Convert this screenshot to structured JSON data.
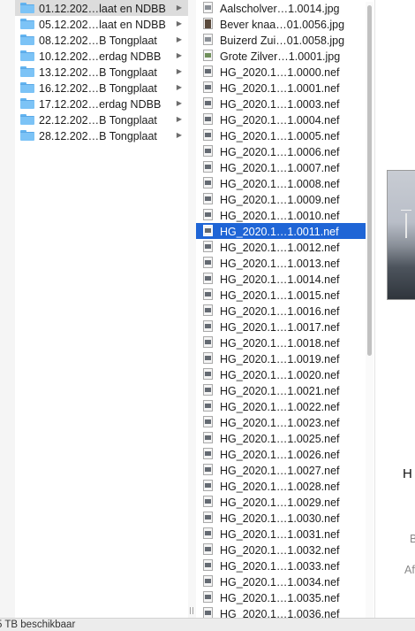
{
  "folders": [
    {
      "name": "01.12.202…laat en NDBB",
      "selected": true
    },
    {
      "name": "05.12.202…laat en NDBB",
      "selected": false
    },
    {
      "name": "08.12.202…B Tongplaat",
      "selected": false
    },
    {
      "name": "10.12.202…erdag NDBB",
      "selected": false
    },
    {
      "name": "13.12.202…B Tongplaat",
      "selected": false
    },
    {
      "name": "16.12.202…B Tongplaat",
      "selected": false
    },
    {
      "name": "17.12.202…erdag NDBB",
      "selected": false
    },
    {
      "name": "22.12.202…B Tongplaat",
      "selected": false
    },
    {
      "name": "28.12.202…B Tongplaat",
      "selected": false
    }
  ],
  "files": [
    {
      "name": "Aalscholver…1.0014.jpg",
      "icon": "image-thumbnail-icon"
    },
    {
      "name": "Bever knaa…01.0056.jpg",
      "icon": "image-thumbnail-icon"
    },
    {
      "name": "Buizerd Zui…01.0058.jpg",
      "icon": "image-thumbnail-icon"
    },
    {
      "name": "Grote Zilver…1.0001.jpg",
      "icon": "image-thumbnail-icon"
    },
    {
      "name": "HG_2020.1…1.0000.nef",
      "icon": "raw-file-icon"
    },
    {
      "name": "HG_2020.1…1.0001.nef",
      "icon": "raw-file-icon"
    },
    {
      "name": "HG_2020.1…1.0003.nef",
      "icon": "raw-file-icon"
    },
    {
      "name": "HG_2020.1…1.0004.nef",
      "icon": "raw-file-icon"
    },
    {
      "name": "HG_2020.1…1.0005.nef",
      "icon": "raw-file-icon"
    },
    {
      "name": "HG_2020.1…1.0006.nef",
      "icon": "raw-file-icon"
    },
    {
      "name": "HG_2020.1…1.0007.nef",
      "icon": "raw-file-icon"
    },
    {
      "name": "HG_2020.1…1.0008.nef",
      "icon": "raw-file-icon"
    },
    {
      "name": "HG_2020.1…1.0009.nef",
      "icon": "raw-file-icon"
    },
    {
      "name": "HG_2020.1…1.0010.nef",
      "icon": "raw-file-icon"
    },
    {
      "name": "HG_2020.1…1.0011.nef",
      "icon": "raw-file-icon",
      "selected": true
    },
    {
      "name": "HG_2020.1…1.0012.nef",
      "icon": "raw-file-icon"
    },
    {
      "name": "HG_2020.1…1.0013.nef",
      "icon": "raw-file-icon"
    },
    {
      "name": "HG_2020.1…1.0014.nef",
      "icon": "raw-file-icon"
    },
    {
      "name": "HG_2020.1…1.0015.nef",
      "icon": "raw-file-icon"
    },
    {
      "name": "HG_2020.1…1.0016.nef",
      "icon": "raw-file-icon"
    },
    {
      "name": "HG_2020.1…1.0017.nef",
      "icon": "raw-file-icon"
    },
    {
      "name": "HG_2020.1…1.0018.nef",
      "icon": "raw-file-icon"
    },
    {
      "name": "HG_2020.1…1.0019.nef",
      "icon": "raw-file-icon"
    },
    {
      "name": "HG_2020.1…1.0020.nef",
      "icon": "raw-file-icon"
    },
    {
      "name": "HG_2020.1…1.0021.nef",
      "icon": "raw-file-icon"
    },
    {
      "name": "HG_2020.1…1.0022.nef",
      "icon": "raw-file-icon"
    },
    {
      "name": "HG_2020.1…1.0023.nef",
      "icon": "raw-file-icon"
    },
    {
      "name": "HG_2020.1…1.0025.nef",
      "icon": "raw-file-icon"
    },
    {
      "name": "HG_2020.1…1.0026.nef",
      "icon": "raw-file-icon"
    },
    {
      "name": "HG_2020.1…1.0027.nef",
      "icon": "raw-file-icon"
    },
    {
      "name": "HG_2020.1…1.0028.nef",
      "icon": "raw-file-icon"
    },
    {
      "name": "HG_2020.1…1.0029.nef",
      "icon": "raw-file-icon"
    },
    {
      "name": "HG_2020.1…1.0030.nef",
      "icon": "raw-file-icon"
    },
    {
      "name": "HG_2020.1…1.0031.nef",
      "icon": "raw-file-icon"
    },
    {
      "name": "HG_2020.1…1.0032.nef",
      "icon": "raw-file-icon"
    },
    {
      "name": "HG_2020.1…1.0033.nef",
      "icon": "raw-file-icon"
    },
    {
      "name": "HG_2020.1…1.0034.nef",
      "icon": "raw-file-icon"
    },
    {
      "name": "HG_2020.1…1.0035.nef",
      "icon": "raw-file-icon"
    },
    {
      "name": "HG_2020.1…1.0036.nef",
      "icon": "raw-file-icon"
    }
  ],
  "preview": {
    "name_fragment": "H",
    "line1": "B",
    "line2": "Af"
  },
  "status_text": "5 TB beschikbaar",
  "colors": {
    "selection_active": "#1f65d6",
    "selection_inactive": "#dcdcdc",
    "folder_blue": "#7cc3f6"
  }
}
